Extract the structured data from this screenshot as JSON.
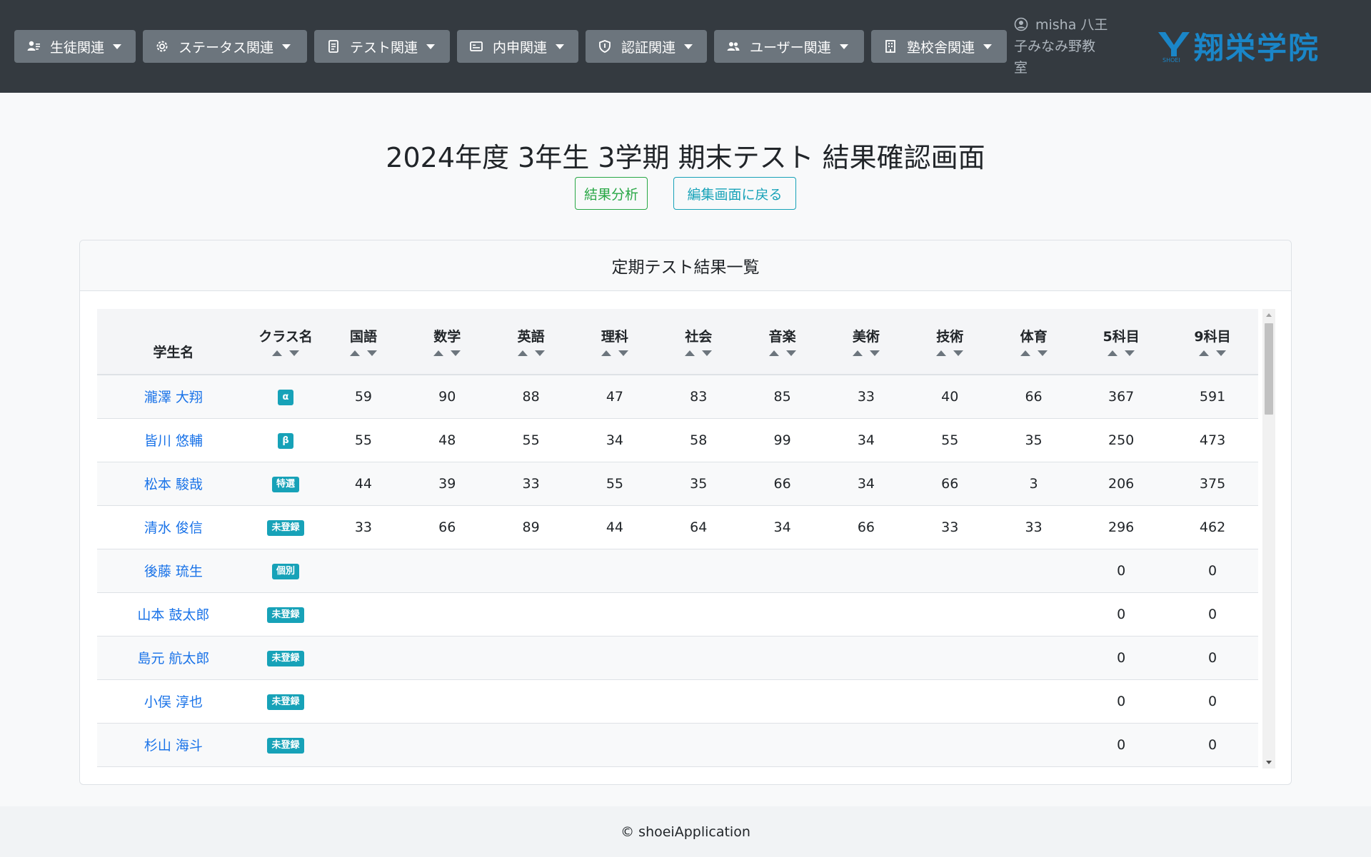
{
  "nav": {
    "menus": [
      {
        "label": "生徒関連",
        "icon": "students-icon"
      },
      {
        "label": "ステータス関連",
        "icon": "gear-icon"
      },
      {
        "label": "テスト関連",
        "icon": "document-icon"
      },
      {
        "label": "内申関連",
        "icon": "card-icon"
      },
      {
        "label": "認証関連",
        "icon": "shield-icon"
      },
      {
        "label": "ユーザー関連",
        "icon": "users-icon"
      },
      {
        "label": "塾校舎関連",
        "icon": "building-icon"
      }
    ],
    "user_line1": "misha 八王",
    "user_line2": "子みなみ野教",
    "user_line3": "室",
    "brand_name": "翔栄学院",
    "brand_small": "SHOEI"
  },
  "page": {
    "title": "2024年度 3年生 3学期 期末テスト 結果確認画面",
    "analysis_button": "結果分析",
    "back_button": "編集画面に戻る"
  },
  "card": {
    "header": "定期テスト結果一覧"
  },
  "table": {
    "columns": [
      "学生名",
      "クラス名",
      "国語",
      "数学",
      "英語",
      "理科",
      "社会",
      "音楽",
      "美術",
      "技術",
      "体育",
      "5科目",
      "9科目"
    ],
    "rows": [
      {
        "name": "瀧澤 大翔",
        "class": "α",
        "scores": [
          "59",
          "90",
          "88",
          "47",
          "83",
          "85",
          "33",
          "40",
          "66"
        ],
        "total5": "367",
        "total9": "591"
      },
      {
        "name": "皆川 悠輔",
        "class": "β",
        "scores": [
          "55",
          "48",
          "55",
          "34",
          "58",
          "99",
          "34",
          "55",
          "35"
        ],
        "total5": "250",
        "total9": "473"
      },
      {
        "name": "松本 駿哉",
        "class": "特選",
        "scores": [
          "44",
          "39",
          "33",
          "55",
          "35",
          "66",
          "34",
          "66",
          "3"
        ],
        "total5": "206",
        "total9": "375"
      },
      {
        "name": "清水 俊信",
        "class": "未登録",
        "scores": [
          "33",
          "66",
          "89",
          "44",
          "64",
          "34",
          "66",
          "33",
          "33"
        ],
        "total5": "296",
        "total9": "462"
      },
      {
        "name": "後藤 琉生",
        "class": "個別",
        "scores": [
          "",
          "",
          "",
          "",
          "",
          "",
          "",
          "",
          ""
        ],
        "total5": "0",
        "total9": "0"
      },
      {
        "name": "山本 鼓太郎",
        "class": "未登録",
        "scores": [
          "",
          "",
          "",
          "",
          "",
          "",
          "",
          "",
          ""
        ],
        "total5": "0",
        "total9": "0"
      },
      {
        "name": "島元 航太郎",
        "class": "未登録",
        "scores": [
          "",
          "",
          "",
          "",
          "",
          "",
          "",
          "",
          ""
        ],
        "total5": "0",
        "total9": "0"
      },
      {
        "name": "小俣 淳也",
        "class": "未登録",
        "scores": [
          "",
          "",
          "",
          "",
          "",
          "",
          "",
          "",
          ""
        ],
        "total5": "0",
        "total9": "0"
      },
      {
        "name": "杉山 海斗",
        "class": "未登録",
        "scores": [
          "",
          "",
          "",
          "",
          "",
          "",
          "",
          "",
          ""
        ],
        "total5": "0",
        "total9": "0"
      }
    ]
  },
  "footer": {
    "text": "© shoeiApplication"
  },
  "colors": {
    "navbar": "#343a40",
    "nav_button": "#6c757d",
    "brand": "#1a86c8",
    "badge": "#17a2b8",
    "success": "#28a745",
    "link": "#1a73e8"
  }
}
